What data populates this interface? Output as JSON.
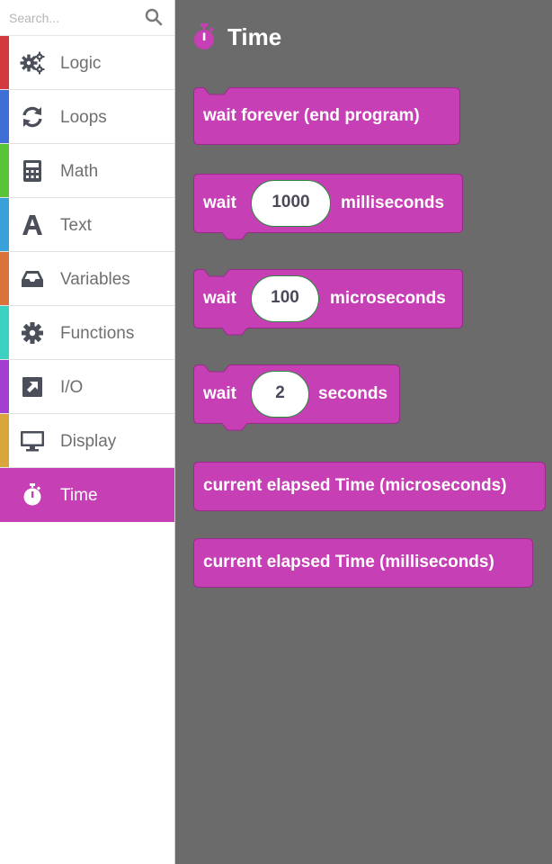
{
  "search": {
    "placeholder": "Search..."
  },
  "sidebar": {
    "items": [
      {
        "label": "Logic",
        "color": "#d13a3f",
        "icon": "gears-icon"
      },
      {
        "label": "Loops",
        "color": "#3f6fd6",
        "icon": "loop-icon"
      },
      {
        "label": "Math",
        "color": "#59c43a",
        "icon": "calculator-icon"
      },
      {
        "label": "Text",
        "color": "#3aa0d8",
        "icon": "text-a-icon"
      },
      {
        "label": "Variables",
        "color": "#d9733a",
        "icon": "inbox-icon"
      },
      {
        "label": "Functions",
        "color": "#3dd1c1",
        "icon": "gear-icon"
      },
      {
        "label": "I/O",
        "color": "#a33fcf",
        "icon": "external-arrow-icon"
      },
      {
        "label": "Display",
        "color": "#d8a63a",
        "icon": "monitor-icon"
      },
      {
        "label": "Time",
        "color": "#c63fb5",
        "icon": "stopwatch-icon",
        "active": true
      }
    ]
  },
  "flyout": {
    "title": "Time",
    "title_icon": "stopwatch-icon",
    "block_color": "#c63fb5",
    "blocks": [
      {
        "text": "wait forever (end program)"
      },
      {
        "prefix": "wait",
        "value": "1000",
        "suffix": "milliseconds"
      },
      {
        "prefix": "wait",
        "value": "100",
        "suffix": "microseconds"
      },
      {
        "prefix": "wait",
        "value": "2",
        "suffix": "seconds"
      },
      {
        "text": "current elapsed Time (microseconds)"
      },
      {
        "text": "current elapsed Time (milliseconds)"
      }
    ]
  }
}
